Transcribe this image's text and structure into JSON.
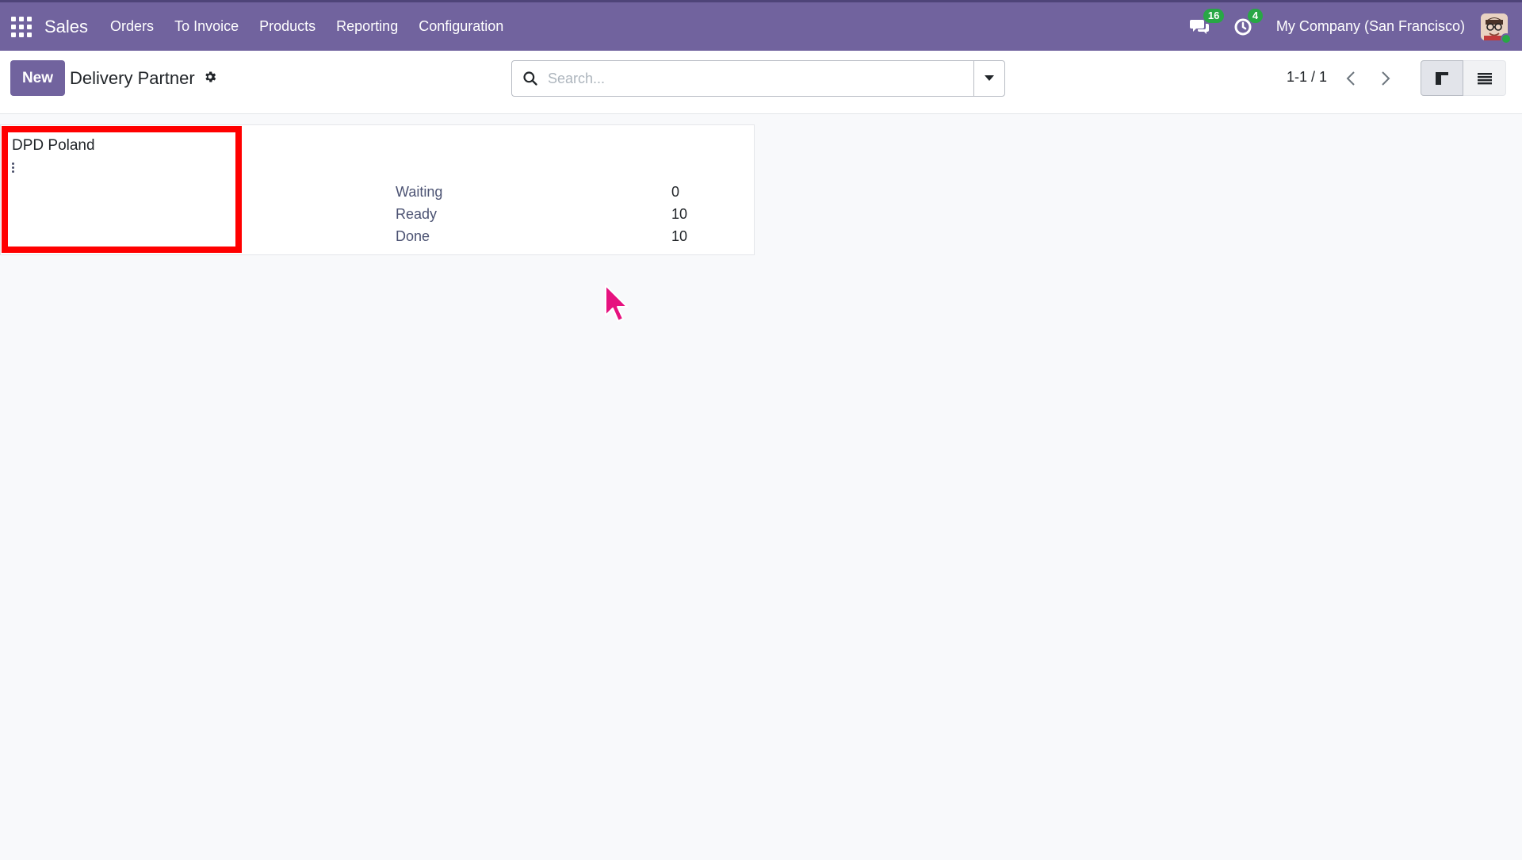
{
  "navbar": {
    "brand": "Sales",
    "menu": [
      "Orders",
      "To Invoice",
      "Products",
      "Reporting",
      "Configuration"
    ],
    "messages_count": "16",
    "activities_count": "4",
    "company": "My Company (San Francisco)"
  },
  "control_panel": {
    "new_label": "New",
    "title": "Delivery Partner",
    "search_placeholder": "Search...",
    "pager": "1-1 / 1"
  },
  "card": {
    "name": "DPD Poland",
    "stats": [
      {
        "label": "Waiting",
        "value": "0"
      },
      {
        "label": "Ready",
        "value": "10"
      },
      {
        "label": "Done",
        "value": "10"
      }
    ]
  },
  "colors": {
    "navbar": "#71639e",
    "primary": "#71639e",
    "highlight": "#ff0000",
    "cursor": "#e6127f",
    "badge": "#28a745"
  }
}
